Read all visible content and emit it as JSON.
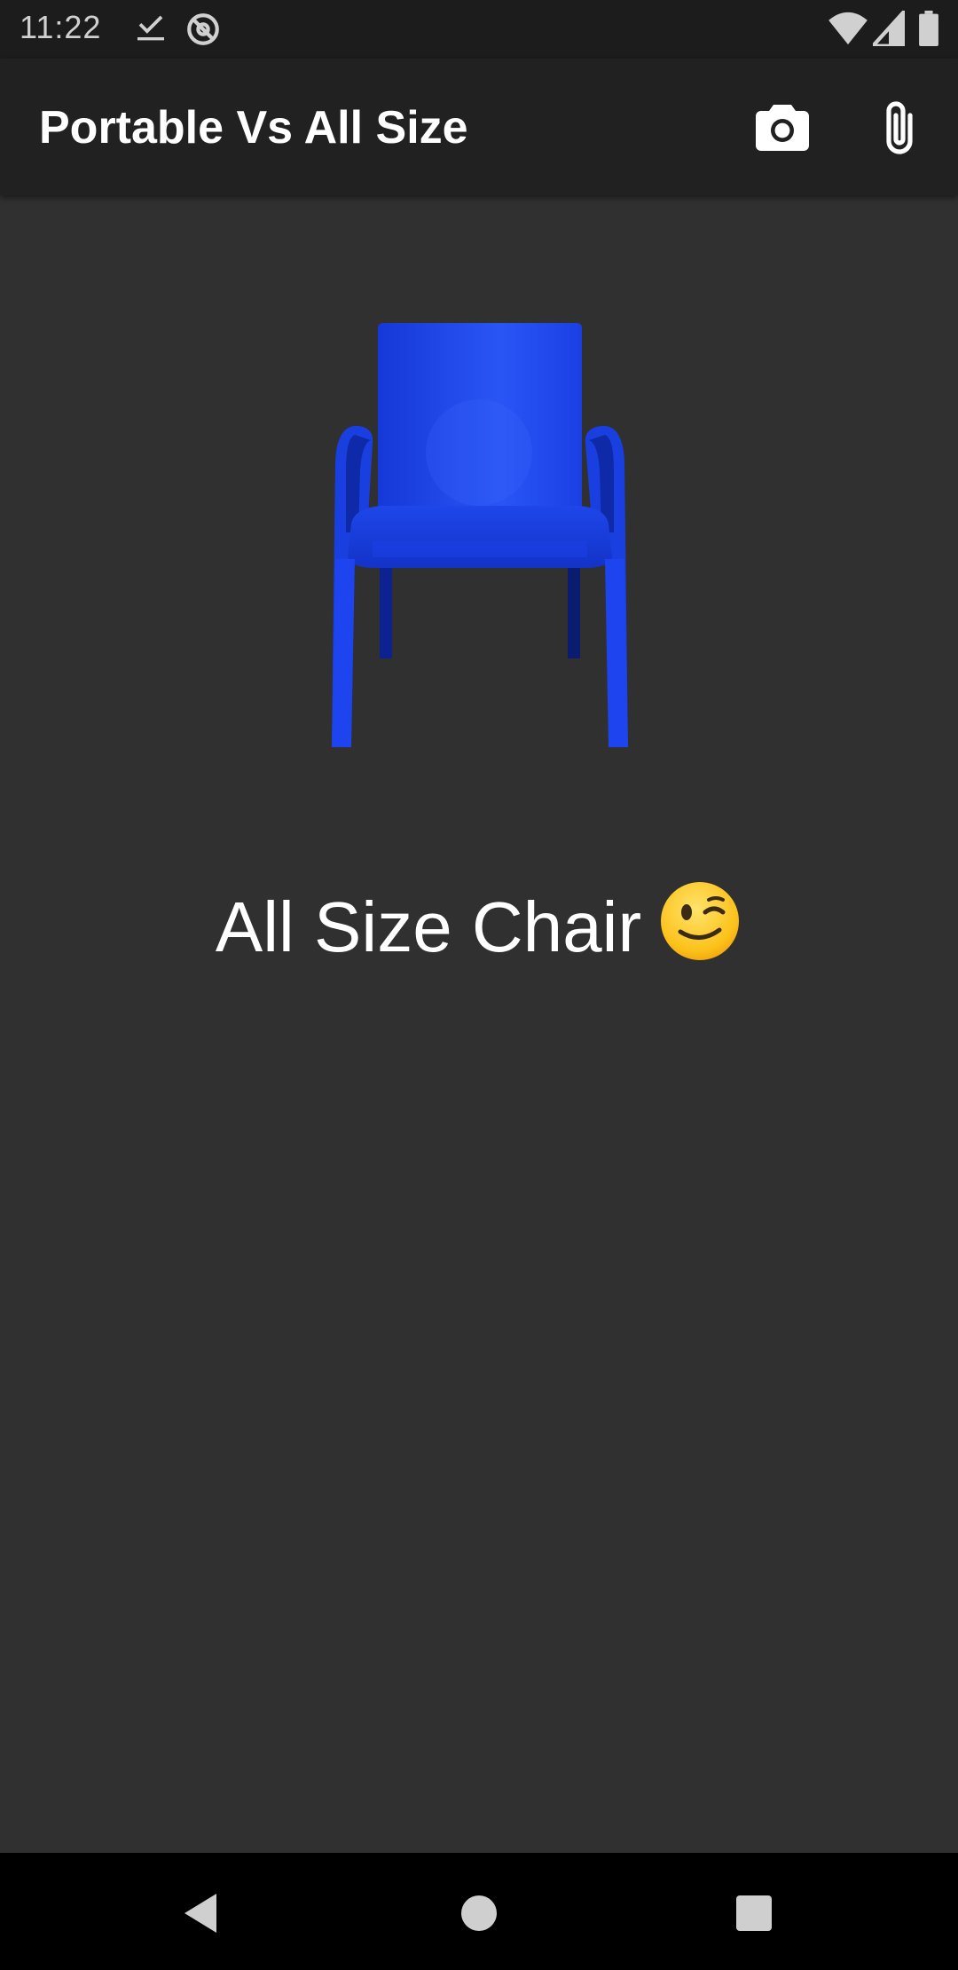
{
  "status_bar": {
    "time": "11:22",
    "icons": [
      "download-done-icon",
      "at-sync-icon",
      "wifi-icon",
      "signal-icon",
      "battery-icon"
    ]
  },
  "app_bar": {
    "title": "Portable Vs All Size",
    "actions": [
      "camera-icon",
      "attach-icon"
    ]
  },
  "main": {
    "image": "blue-plastic-chair",
    "caption": "All Size Chair",
    "caption_emoji": "winking-face"
  },
  "navigation": {
    "buttons": [
      "back-icon",
      "home-icon",
      "recents-icon"
    ]
  },
  "colors": {
    "background": "#303030",
    "app_bar": "#212121",
    "chair": "#1a3fe0",
    "text": "#ffffff"
  }
}
